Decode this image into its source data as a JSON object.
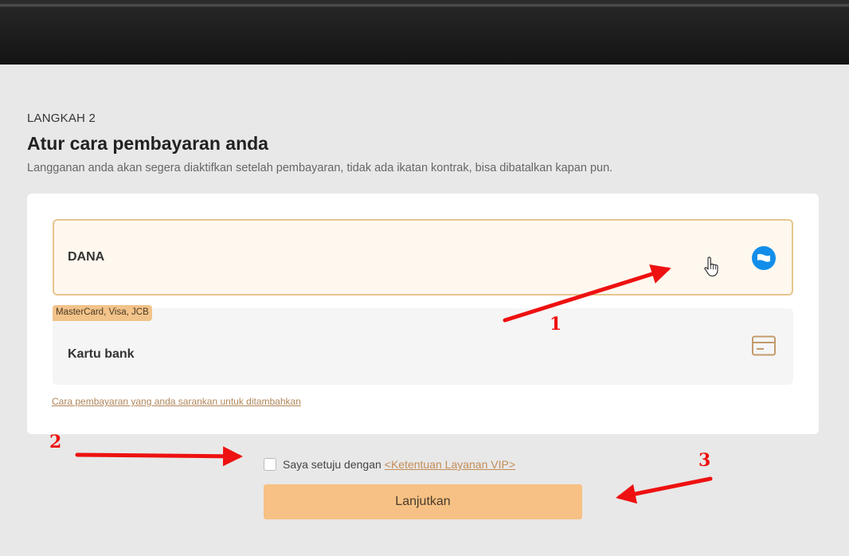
{
  "step": {
    "label": "LANGKAH 2",
    "title": "Atur cara pembayaran anda",
    "subtitle": "Langganan anda akan segera diaktifkan setelah pembayaran, tidak ada ikatan kontrak, bisa dibatalkan kapan pun."
  },
  "payment_options": [
    {
      "label": "DANA",
      "icon": "dana-wallet-icon",
      "selected": true
    },
    {
      "label": "Kartu bank",
      "icon": "credit-card-icon",
      "badge": "MasterCard, Visa, JCB",
      "selected": false
    }
  ],
  "suggest_link": "Cara pembayaran yang anda sarankan untuk ditambahkan",
  "agreement": {
    "text": "Saya setuju dengan",
    "link": "<Ketentuan Layanan VIP>",
    "checked": false
  },
  "continue_button": "Lanjutkan",
  "annotations": [
    "1",
    "2",
    "3"
  ],
  "colors": {
    "accent": "#f7c185",
    "selected_border": "#e6c68e",
    "link": "#c48d58",
    "annotation": "#ee1111"
  }
}
